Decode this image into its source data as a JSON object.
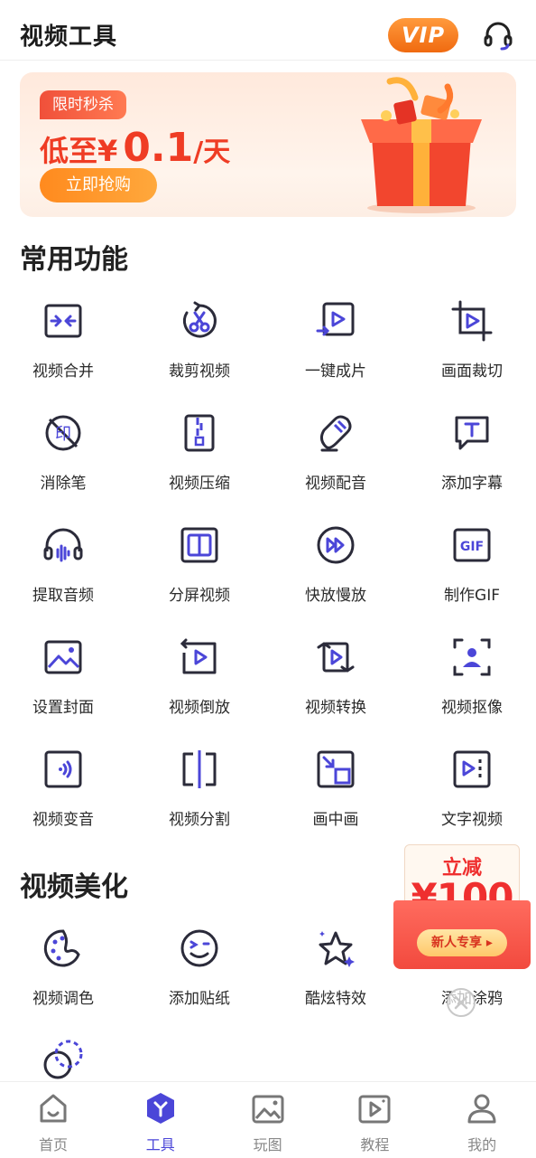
{
  "header": {
    "title": "视频工具",
    "vip_label": "VIP",
    "support_icon": "headset-icon"
  },
  "banner": {
    "tag": "限时秒杀",
    "price_prefix": "低至¥",
    "price_value": "0.1",
    "price_unit": "/天",
    "button": "立即抢购",
    "image": "gift-box-icon"
  },
  "common": {
    "title": "常用功能",
    "items": [
      {
        "label": "视频合并",
        "icon": "merge-icon"
      },
      {
        "label": "裁剪视频",
        "icon": "scissors-icon"
      },
      {
        "label": "一键成片",
        "icon": "play-import-icon"
      },
      {
        "label": "画面裁切",
        "icon": "crop-icon"
      },
      {
        "label": "消除笔",
        "icon": "erase-stamp-icon"
      },
      {
        "label": "视频压缩",
        "icon": "zip-icon"
      },
      {
        "label": "视频配音",
        "icon": "microphone-icon"
      },
      {
        "label": "添加字幕",
        "icon": "subtitle-icon"
      },
      {
        "label": "提取音频",
        "icon": "headphones-icon"
      },
      {
        "label": "分屏视频",
        "icon": "split-screen-icon"
      },
      {
        "label": "快放慢放",
        "icon": "fast-forward-icon"
      },
      {
        "label": "制作GIF",
        "icon": "gif-icon"
      },
      {
        "label": "设置封面",
        "icon": "image-icon"
      },
      {
        "label": "视频倒放",
        "icon": "reverse-icon"
      },
      {
        "label": "视频转换",
        "icon": "convert-icon"
      },
      {
        "label": "视频抠像",
        "icon": "portrait-icon"
      },
      {
        "label": "视频变音",
        "icon": "voice-change-icon"
      },
      {
        "label": "视频分割",
        "icon": "split-icon"
      },
      {
        "label": "画中画",
        "icon": "pip-icon"
      },
      {
        "label": "文字视频",
        "icon": "text-video-icon"
      }
    ]
  },
  "beautify": {
    "title": "视频美化",
    "items": [
      {
        "label": "视频调色",
        "icon": "palette-icon"
      },
      {
        "label": "添加贴纸",
        "icon": "sticker-icon"
      },
      {
        "label": "酷炫特效",
        "icon": "sparkle-star-icon"
      },
      {
        "label": "添加涂鸦",
        "icon": "doodle-icon"
      },
      {
        "label": "",
        "icon": "overlap-circles-icon"
      }
    ]
  },
  "coupon": {
    "line1": "立减",
    "amount": "¥100",
    "button": "新人专享 ▸"
  },
  "nav": {
    "items": [
      {
        "label": "首页",
        "icon": "home-icon"
      },
      {
        "label": "工具",
        "icon": "tools-icon"
      },
      {
        "label": "玩图",
        "icon": "picture-icon"
      },
      {
        "label": "教程",
        "icon": "tutorial-icon"
      },
      {
        "label": "我的",
        "icon": "profile-icon"
      }
    ],
    "active": "工具"
  },
  "colors": {
    "accent": "#4b46d8",
    "icon_stroke": "#2b2b3a",
    "promo_red": "#ef3c24",
    "promo_orange": "#ff8a1e"
  }
}
